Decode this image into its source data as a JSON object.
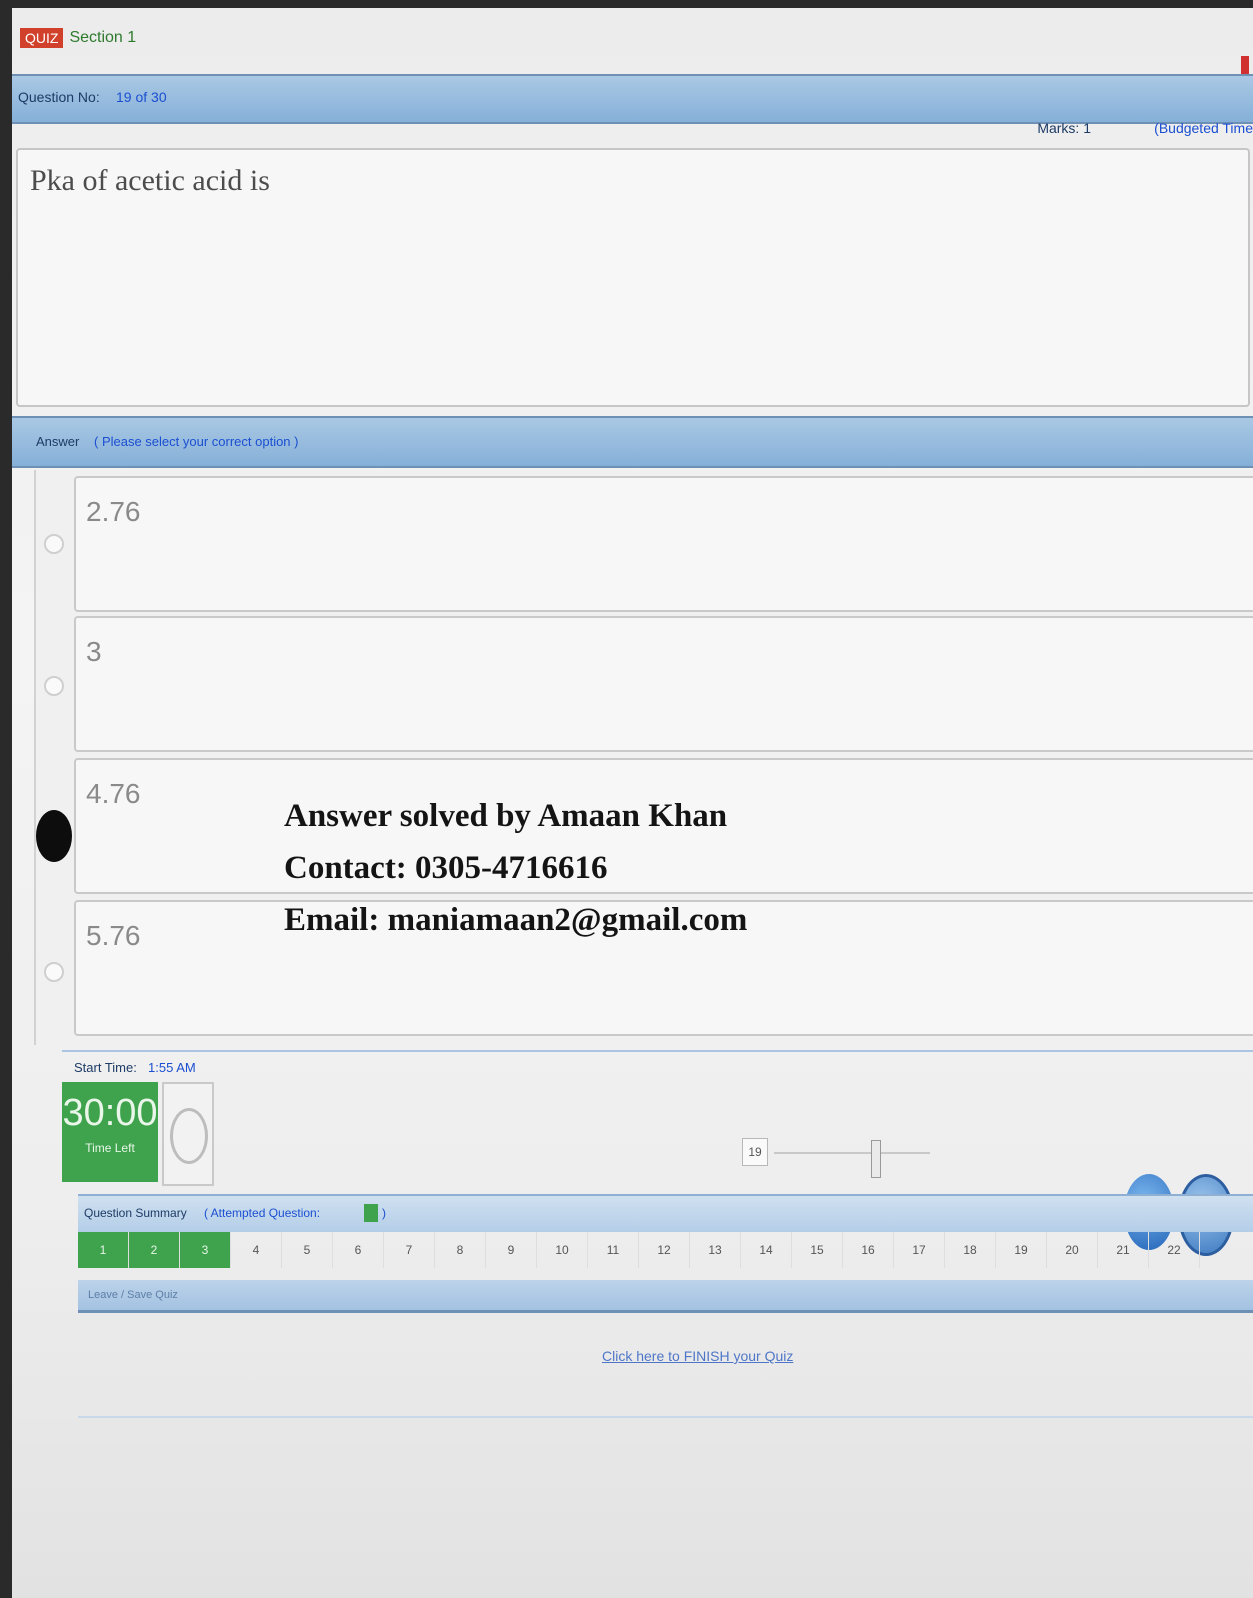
{
  "header": {
    "tag": "QUIZ",
    "title": "Section 1",
    "question_label": "Question No:",
    "question_value": "19 of 30",
    "marks_label": "Marks: 1",
    "marks_value": "(Budgeted Time"
  },
  "question": {
    "text": "Pka of acetic acid is"
  },
  "answer_bar": {
    "label": "Answer",
    "hint": "( Please select your correct option )"
  },
  "options": [
    {
      "text": "2.76",
      "selected": false
    },
    {
      "text": "3",
      "selected": false
    },
    {
      "text": "4.76",
      "selected": true
    },
    {
      "text": "5.76",
      "selected": false
    }
  ],
  "watermark": {
    "line1": "Answer solved by Amaan Khan",
    "line2": "Contact: 0305-4716616",
    "line3": "Email: maniamaan2@gmail.com"
  },
  "timer": {
    "start_label": "Start Time:",
    "start_value": "1:55 AM",
    "time_left": "30:00",
    "time_left_label": "Time Left",
    "slider_value": "19",
    "slider_fraction": 0.65
  },
  "summary": {
    "label": "Question Summary",
    "attempted_label": "( Attempted Question:",
    "attempted_color": "#3fa34d",
    "attempted_suffix": ")",
    "questions": [
      "1",
      "2",
      "3",
      "4",
      "5",
      "6",
      "7",
      "8",
      "9",
      "10",
      "11",
      "12",
      "13",
      "14",
      "15",
      "16",
      "17",
      "18",
      "19",
      "20",
      "21",
      "22"
    ],
    "attempted": [
      "1",
      "2",
      "3"
    ]
  },
  "footer": {
    "left_text": "Leave / Save Quiz",
    "finish_link": "Click here to FINISH your Quiz"
  },
  "icons": {
    "info": "info-icon",
    "first": "first-page-icon",
    "clock": "clock-icon"
  }
}
